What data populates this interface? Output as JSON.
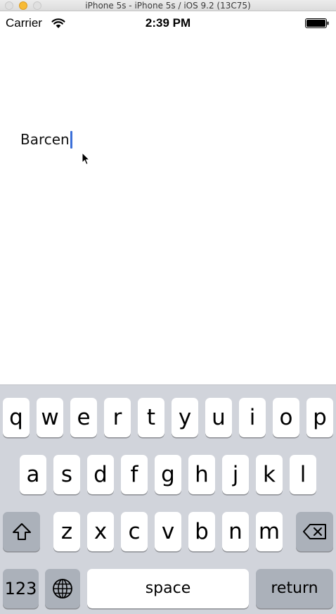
{
  "window": {
    "title": "iPhone 5s - iPhone 5s / iOS 9.2 (13C75)"
  },
  "status_bar": {
    "carrier": "Carrier",
    "time": "2:39 PM",
    "wifi_icon": "wifi-icon",
    "battery_icon": "battery-icon"
  },
  "text_field": {
    "value": "Barcen"
  },
  "keyboard": {
    "row1": [
      "q",
      "w",
      "e",
      "r",
      "t",
      "y",
      "u",
      "i",
      "o",
      "p"
    ],
    "row2": [
      "a",
      "s",
      "d",
      "f",
      "g",
      "h",
      "j",
      "k",
      "l"
    ],
    "row3": [
      "z",
      "x",
      "c",
      "v",
      "b",
      "n",
      "m"
    ],
    "shift_icon": "shift-icon",
    "delete_icon": "delete-backspace-icon",
    "numbers_label": "123",
    "globe_icon": "globe-icon",
    "space_label": "space",
    "return_label": "return"
  },
  "colors": {
    "keyboard_bg": "#d1d4db",
    "key_bg": "#ffffff",
    "function_key_bg": "#abb1ba",
    "caret": "#3b6fd8"
  }
}
